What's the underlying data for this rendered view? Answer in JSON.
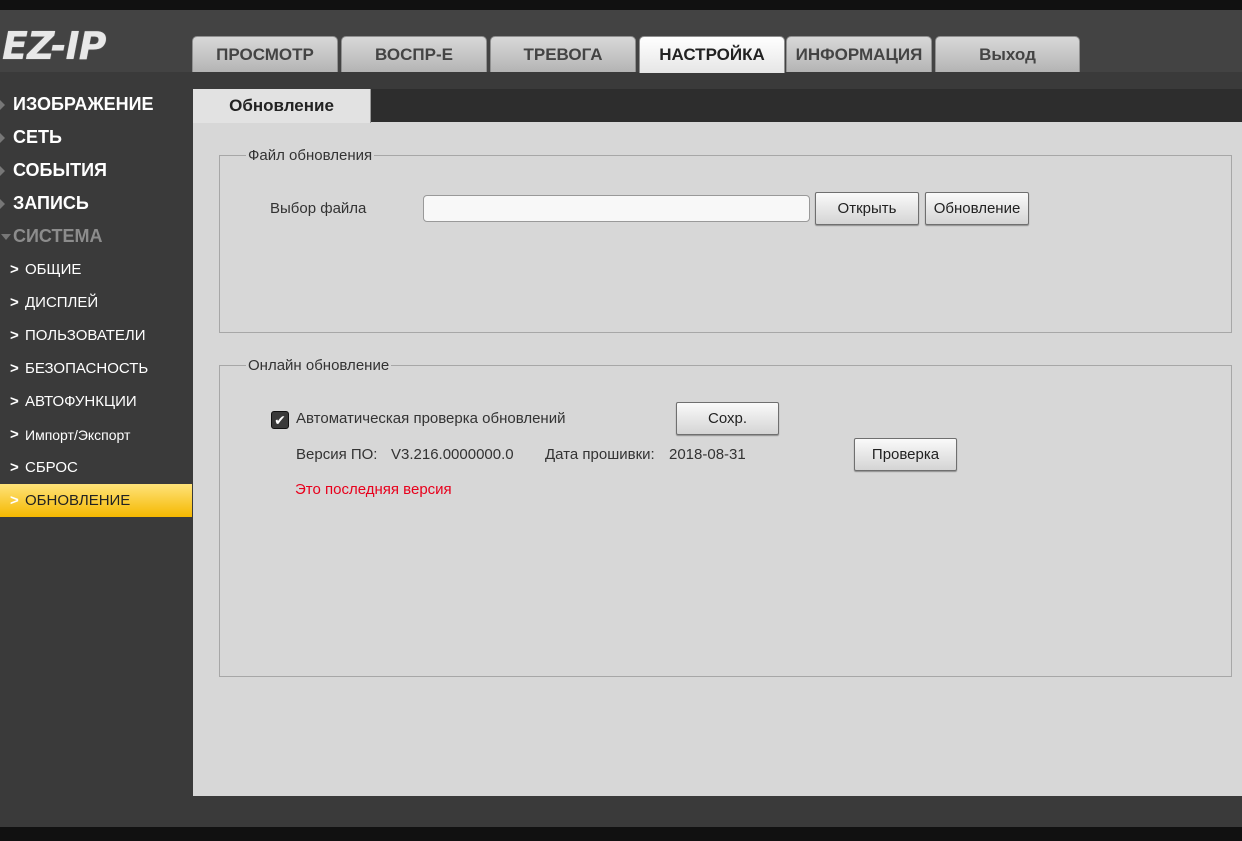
{
  "logo": "EZ-IP",
  "tabs": [
    "ПРОСМОТР",
    "ВОСПР-Е",
    "ТРЕВОГА",
    "НАСТРОЙКА",
    "ИНФОРМАЦИЯ",
    "Выход"
  ],
  "active_tab": "НАСТРОЙКА",
  "sidebar": {
    "sections": [
      "ИЗОБРАЖЕНИЕ",
      "СЕТЬ",
      "СОБЫТИЯ",
      "ЗАПИСЬ",
      "СИСТЕМА"
    ],
    "items": [
      "ОБЩИЕ",
      "ДИСПЛЕЙ",
      "ПОЛЬЗОВАТЕЛИ",
      "БЕЗОПАСНОСТЬ",
      "АВТОФУНКЦИИ",
      "Импорт/Экспорт",
      "СБРОС",
      "ОБНОВЛЕНИЕ"
    ],
    "active_item": "ОБНОВЛЕНИЕ"
  },
  "content_tab": "Обновление",
  "file_update": {
    "legend": "Файл обновления",
    "label": "Выбор файла",
    "file_value": "",
    "open_button": "Открыть",
    "update_button": "Обновление"
  },
  "online_update": {
    "legend": "Онлайн обновление",
    "auto_check_label": "Автоматическая проверка обновлений",
    "auto_check_checked": true,
    "save_button": "Сохр.",
    "version_label": "Версия ПО:",
    "version_value": "V3.216.0000000.0",
    "date_label": "Дата прошивки:",
    "date_value": "2018-08-31",
    "check_button": "Проверка",
    "status": "Это последняя версия"
  },
  "colors": {
    "accent": "#f5b800",
    "status_text": "#e8001c"
  }
}
